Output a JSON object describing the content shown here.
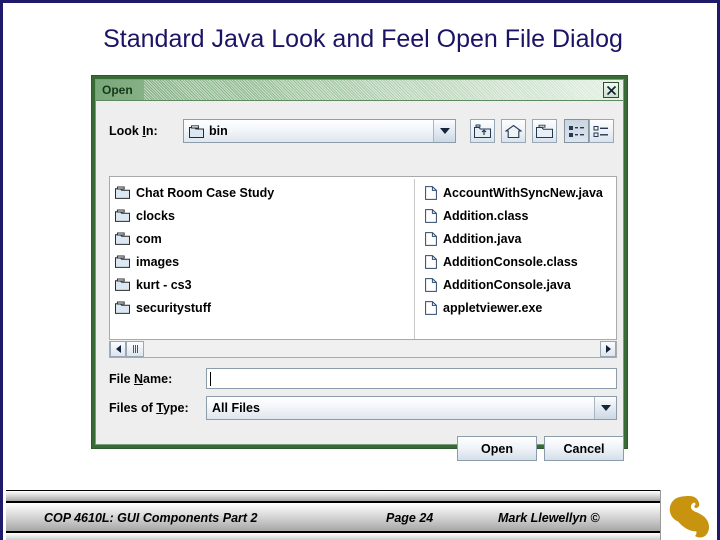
{
  "slide": {
    "title": "Standard Java Look and Feel Open File Dialog",
    "title_color": "#1b1464",
    "border_color": "#201a6b"
  },
  "dialog": {
    "titlebar": {
      "title": "Open",
      "close_icon": "close-x-icon",
      "accent_color": "#366b36"
    },
    "lookin": {
      "label": "Look In:",
      "value": "bin",
      "value_icon": "folder-icon",
      "dropdown_icon": "chevron-down-icon"
    },
    "toolbar": [
      {
        "name": "up-one-level-button",
        "icon": "up-folder-icon"
      },
      {
        "name": "home-button",
        "icon": "home-icon"
      },
      {
        "name": "new-folder-button",
        "icon": "new-folder-icon"
      },
      {
        "name": "list-view-button",
        "icon": "list-view-icon",
        "selected": true
      },
      {
        "name": "details-view-button",
        "icon": "details-view-icon",
        "selected": false
      }
    ],
    "filelist": {
      "column1": [
        {
          "name": "Chat Room Case Study",
          "icon": "folder-icon"
        },
        {
          "name": "clocks",
          "icon": "folder-icon"
        },
        {
          "name": "com",
          "icon": "folder-icon"
        },
        {
          "name": "images",
          "icon": "folder-icon"
        },
        {
          "name": "kurt - cs3",
          "icon": "folder-icon"
        },
        {
          "name": "securitystuff",
          "icon": "folder-icon"
        }
      ],
      "column2": [
        {
          "name": "AccountWithSyncNew.java",
          "icon": "file-icon"
        },
        {
          "name": "Addition.class",
          "icon": "file-icon"
        },
        {
          "name": "Addition.java",
          "icon": "file-icon"
        },
        {
          "name": "AdditionConsole.class",
          "icon": "file-icon"
        },
        {
          "name": "AdditionConsole.java",
          "icon": "file-icon"
        },
        {
          "name": "appletviewer.exe",
          "icon": "file-icon"
        }
      ]
    },
    "scrollbar": {
      "left_icon": "arrow-left-icon",
      "right_icon": "arrow-right-icon"
    },
    "filename": {
      "label": "File Name:",
      "value": "",
      "placeholder": ""
    },
    "filetype": {
      "label": "Files of Type:",
      "value": "All Files",
      "dropdown_icon": "chevron-down-icon"
    },
    "buttons": {
      "open": "Open",
      "cancel": "Cancel"
    }
  },
  "footer": {
    "course": "COP 4610L: GUI Components Part 2",
    "page": "Page 24",
    "author": "Mark Llewellyn ©",
    "logo": "pegasus-logo",
    "logo_color": "#c8940f"
  }
}
